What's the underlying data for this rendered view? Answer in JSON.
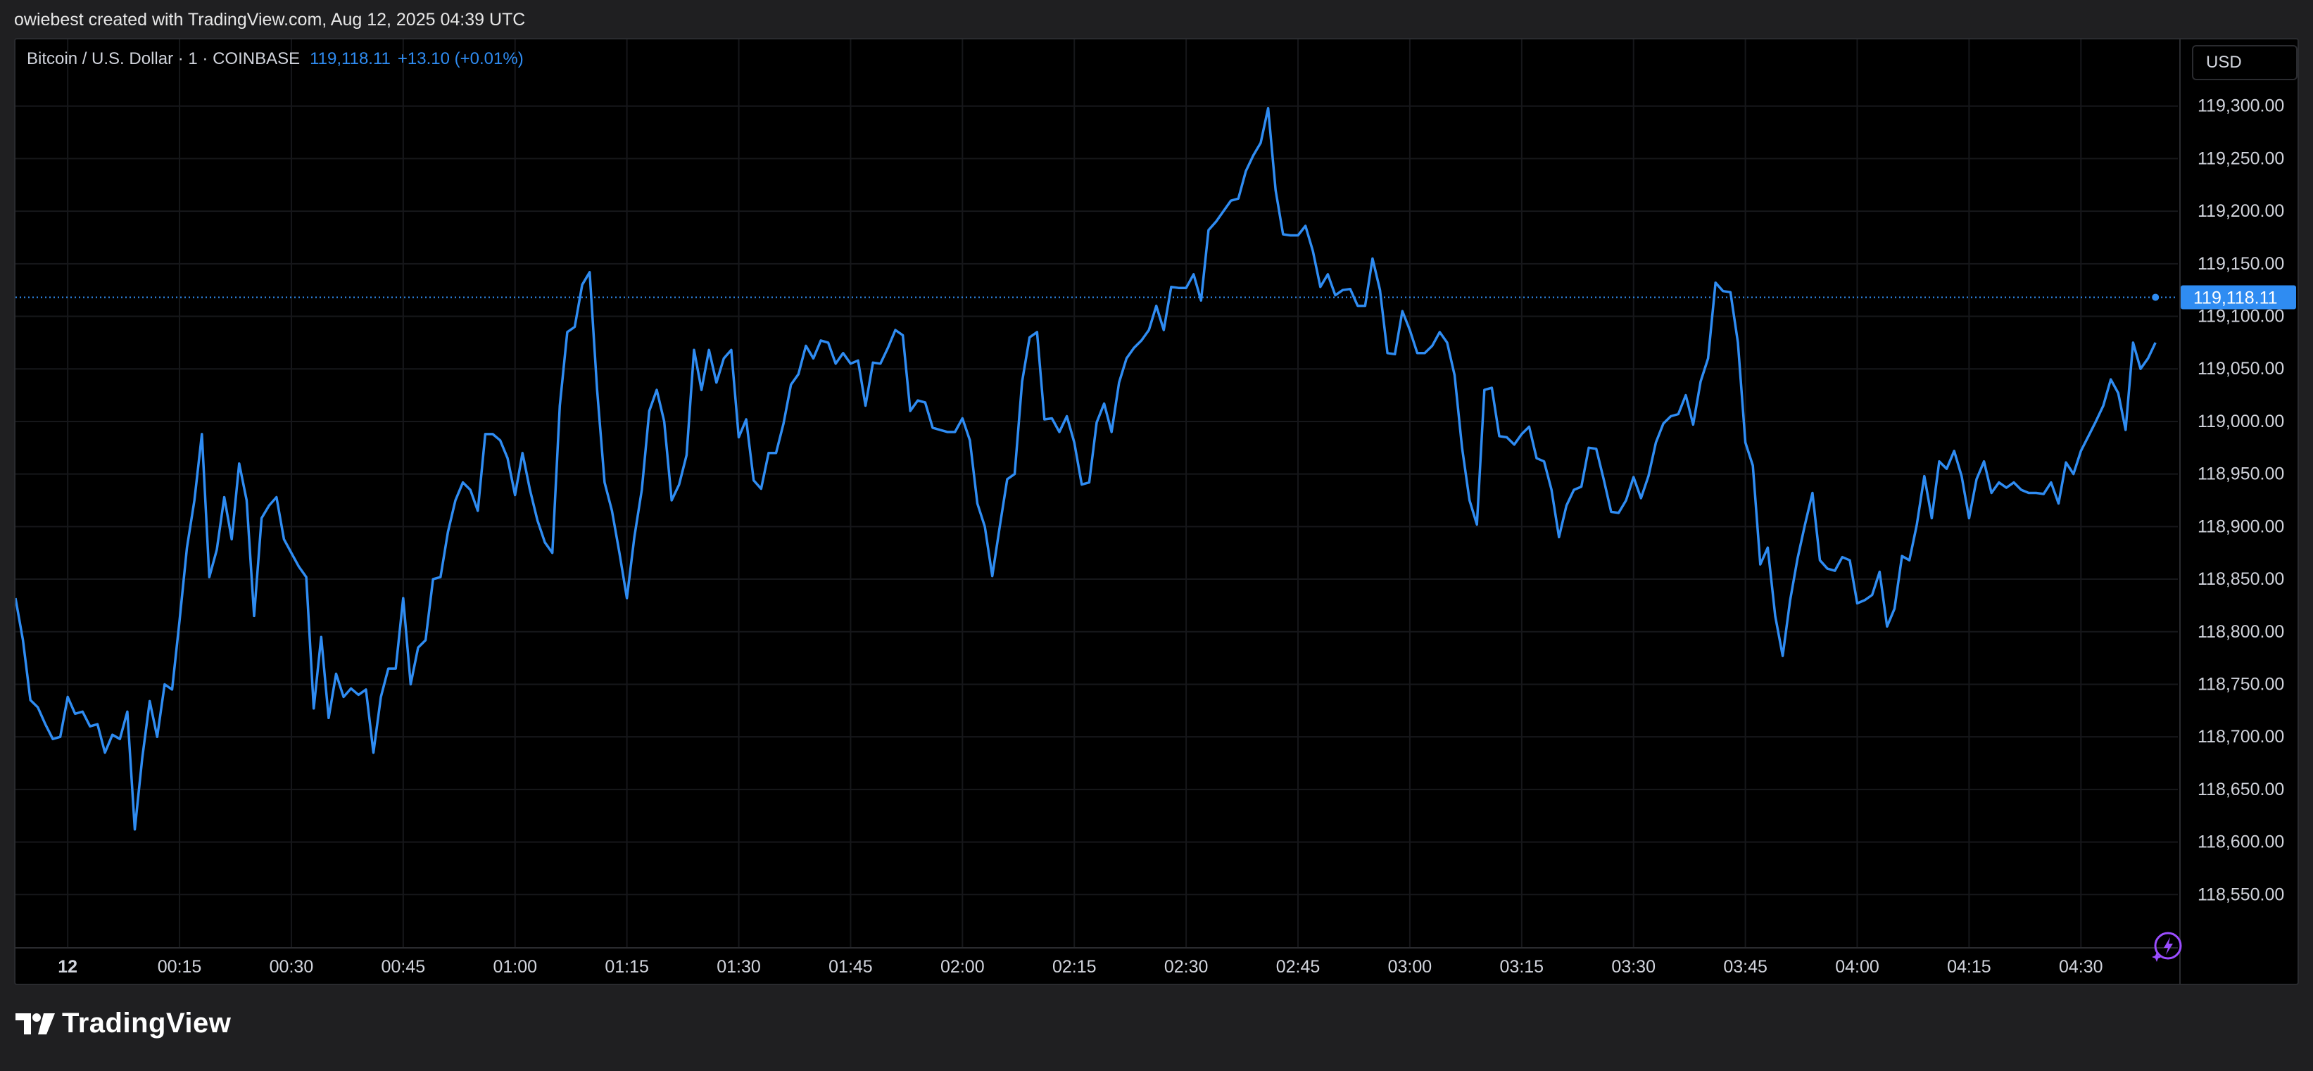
{
  "attribution": "owiebest created with TradingView.com, Aug 12, 2025 04:39 UTC",
  "header": {
    "symbol": "Bitcoin / U.S. Dollar · 1 · COINBASE",
    "price": "119,118.11",
    "change": "+13.10 (+0.01%)"
  },
  "currency_button": "USD",
  "current_price_label": "119,118.11",
  "logo_text": "TradingView",
  "colors": {
    "line": "#2f8cf2",
    "background": "#000000",
    "grid": "#16171a",
    "price_badge": "#2f8cf2"
  },
  "chart_data": {
    "type": "line",
    "title": "",
    "xlabel": "",
    "ylabel": "",
    "ylim": [
      118500,
      119350
    ],
    "y_ticks": [
      119300,
      119250,
      119200,
      119150,
      119100,
      119050,
      119000,
      118950,
      118900,
      118850,
      118800,
      118750,
      118700,
      118650,
      118600,
      118550
    ],
    "y_tick_labels": [
      "119,300.00",
      "119,250.00",
      "119,200.00",
      "119,150.00",
      "119,100.00",
      "119,050.00",
      "119,000.00",
      "118,950.00",
      "118,900.00",
      "118,850.00",
      "118,800.00",
      "118,750.00",
      "118,700.00",
      "118,650.00",
      "118,600.00",
      "118,550.00"
    ],
    "x_tick_labels": [
      "12",
      "00:15",
      "00:30",
      "00:45",
      "01:00",
      "01:15",
      "01:30",
      "01:45",
      "02:00",
      "02:15",
      "02:30",
      "02:45",
      "03:00",
      "03:15",
      "03:30",
      "03:45",
      "04:00",
      "04:15",
      "04:30"
    ],
    "x_tick_minutes": [
      0,
      15,
      30,
      45,
      60,
      75,
      90,
      105,
      120,
      135,
      150,
      165,
      180,
      195,
      210,
      225,
      240,
      255,
      270
    ],
    "x_range_minutes": [
      -7,
      283
    ],
    "current_price": 119118.11,
    "grid": true,
    "series": [
      {
        "minutes": [
          -7,
          -6,
          -5,
          -4,
          -3,
          -2,
          -1,
          0,
          1,
          2,
          3,
          4,
          5,
          6,
          7,
          8,
          9,
          10,
          11,
          12,
          13,
          14,
          15,
          16,
          17,
          18,
          19,
          20,
          21,
          22,
          23,
          24,
          25,
          26,
          27,
          28,
          29,
          30,
          31,
          32,
          33,
          34,
          35,
          36,
          37,
          38,
          39,
          40,
          41,
          42,
          43,
          44,
          45,
          46,
          47,
          48,
          49,
          50,
          51,
          52,
          53,
          54,
          55,
          56,
          57,
          58,
          59,
          60,
          61,
          62,
          63,
          64,
          65,
          66,
          67,
          68,
          69,
          70,
          71,
          72,
          73,
          74,
          75,
          76,
          77,
          78,
          79,
          80,
          81,
          82,
          83,
          84,
          85,
          86,
          87,
          88,
          89,
          90,
          91,
          92,
          93,
          94,
          95,
          96,
          97,
          98,
          99,
          100,
          101,
          102,
          103,
          104,
          105,
          106,
          107,
          108,
          109,
          110,
          111,
          112,
          113,
          114,
          115,
          116,
          117,
          118,
          119,
          120,
          121,
          122,
          123,
          124,
          125,
          126,
          127,
          128,
          129,
          130,
          131,
          132,
          133,
          134,
          135,
          136,
          137,
          138,
          139,
          140,
          141,
          142,
          143,
          144,
          145,
          146,
          147,
          148,
          149,
          150,
          151,
          152,
          153,
          154,
          155,
          156,
          157,
          158,
          159,
          160,
          161,
          162,
          163,
          164,
          165,
          166,
          167,
          168,
          169,
          170,
          171,
          172,
          173,
          174,
          175,
          176,
          177,
          178,
          179,
          180,
          181,
          182,
          183,
          184,
          185,
          186,
          187,
          188,
          189,
          190,
          191,
          192,
          193,
          194,
          195,
          196,
          197,
          198,
          199,
          200,
          201,
          202,
          203,
          204,
          205,
          206,
          207,
          208,
          209,
          210,
          211,
          212,
          213,
          214,
          215,
          216,
          217,
          218,
          219,
          220,
          221,
          222,
          223,
          224,
          225,
          226,
          227,
          228,
          229,
          230,
          231,
          232,
          233,
          234,
          235,
          236,
          237,
          238,
          239,
          240,
          241,
          242,
          243,
          244,
          245,
          246,
          247,
          248,
          249,
          250,
          251,
          252,
          253,
          254,
          255,
          256,
          257,
          258,
          259,
          260,
          261,
          262,
          263,
          264,
          265,
          266,
          267,
          268,
          269,
          270,
          271,
          272,
          273,
          274,
          275,
          276,
          277,
          278,
          279,
          280
        ],
        "values": [
          118832,
          118792,
          118735,
          118728,
          118712,
          118698,
          118700,
          118738,
          118722,
          118724,
          118710,
          118712,
          118685,
          118702,
          118698,
          118724,
          118612,
          118680,
          118734,
          118700,
          118750,
          118745,
          118810,
          118880,
          118925,
          118988,
          118852,
          118878,
          118928,
          118888,
          118960,
          118925,
          118815,
          118908,
          118920,
          118928,
          118888,
          118875,
          118862,
          118852,
          118727,
          118795,
          118718,
          118760,
          118738,
          118746,
          118740,
          118745,
          118685,
          118738,
          118765,
          118765,
          118832,
          118750,
          118785,
          118792,
          118850,
          118852,
          118895,
          118925,
          118942,
          118935,
          118915,
          118988,
          118988,
          118982,
          118965,
          118930,
          118970,
          118935,
          118906,
          118885,
          118875,
          119015,
          119085,
          119090,
          119130,
          119142,
          119030,
          118942,
          118915,
          118875,
          118832,
          118890,
          118935,
          119010,
          119030,
          119000,
          118925,
          118940,
          118968,
          119068,
          119030,
          119068,
          119037,
          119060,
          119068,
          118985,
          119002,
          118944,
          118936,
          118970,
          118970,
          118998,
          119035,
          119045,
          119072,
          119060,
          119077,
          119075,
          119055,
          119065,
          119055,
          119058,
          119015,
          119056,
          119055,
          119070,
          119087,
          119082,
          119010,
          119020,
          119018,
          118994,
          118992,
          118990,
          118990,
          119003,
          118982,
          118922,
          118900,
          118853,
          118900,
          118945,
          118950,
          119038,
          119080,
          119085,
          119002,
          119003,
          118990,
          119005,
          118980,
          118940,
          118942,
          118999,
          119017,
          118990,
          119037,
          119060,
          119070,
          119077,
          119087,
          119110,
          119087,
          119128,
          119127,
          119127,
          119140,
          119115,
          119182,
          119190,
          119200,
          119210,
          119212,
          119238,
          119253,
          119265,
          119298,
          119220,
          119178,
          119177,
          119177,
          119186,
          119162,
          119128,
          119140,
          119120,
          119125,
          119126,
          119110,
          119110,
          119155,
          119125,
          119065,
          119064,
          119105,
          119087,
          119065,
          119065,
          119072,
          119085,
          119075,
          119044,
          118975,
          118925,
          118902,
          119030,
          119032,
          118986,
          118985,
          118978,
          118988,
          118995,
          118965,
          118962,
          118935,
          118890,
          118920,
          118935,
          118938,
          118975,
          118974,
          118945,
          118914,
          118913,
          118925,
          118947,
          118927,
          118948,
          118980,
          118998,
          119005,
          119007,
          119025,
          118997,
          119038,
          119060,
          119132,
          119124,
          119123,
          119075,
          118980,
          118958,
          118864,
          118880,
          118815,
          118777,
          118830,
          118870,
          118902,
          118932,
          118868,
          118860,
          118858,
          118871,
          118868,
          118827,
          118830,
          118835,
          118857,
          118805,
          118822,
          118872,
          118868,
          118902,
          118948,
          118908,
          118962,
          118955,
          118972,
          118948,
          118908,
          118945,
          118962,
          118932,
          118942,
          118937,
          118942,
          118935,
          118932,
          118932,
          118931,
          118942,
          118922,
          118961,
          118950,
          118972,
          118986,
          119000,
          119015,
          119040,
          119027,
          118992,
          119075,
          119050,
          119060,
          119075,
          119110,
          119042,
          119040,
          119100,
          119112,
          119118.11
        ]
      }
    ]
  }
}
